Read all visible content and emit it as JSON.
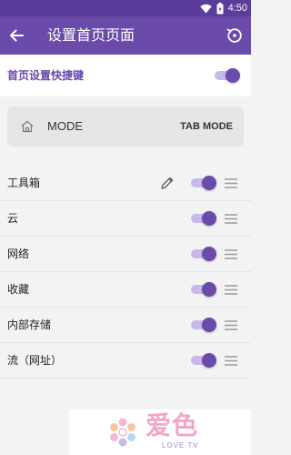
{
  "status_bar": {
    "time": "4:50",
    "icons": [
      "wifi-icon",
      "battery-icon"
    ]
  },
  "app_bar": {
    "title": "设置首页页面",
    "back_icon": "arrow-back-icon",
    "reset_icon": "restore-icon",
    "background": "#6a4baa"
  },
  "shortcut": {
    "label": "首页设置快捷键",
    "enabled": true
  },
  "mode": {
    "icon": "home-icon",
    "label": "MODE",
    "value": "TAB MODE"
  },
  "toolbox": {
    "items": [
      {
        "name": "工具箱",
        "enabled": true,
        "editable": true
      },
      {
        "name": "云",
        "enabled": true,
        "editable": false
      },
      {
        "name": "网络",
        "enabled": true,
        "editable": false
      },
      {
        "name": "收藏",
        "enabled": true,
        "editable": false
      },
      {
        "name": "内部存储",
        "enabled": true,
        "editable": false
      },
      {
        "name": "流（网址）",
        "enabled": true,
        "editable": false
      }
    ]
  },
  "watermark": {
    "brand": "爱色",
    "sub": "LOVE TV"
  },
  "colors": {
    "accent": "#6a4baa",
    "accent_light": "#c9b9ea",
    "status_bar": "#5a3c9a",
    "background": "#f3f3f4"
  }
}
